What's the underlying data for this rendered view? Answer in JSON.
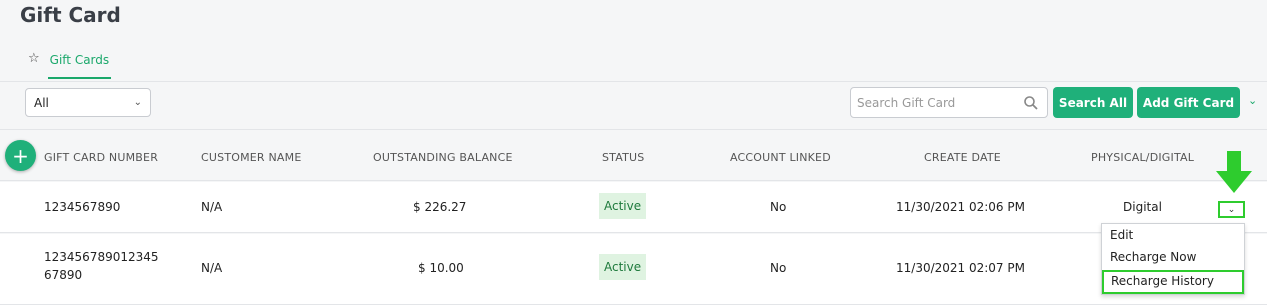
{
  "page": {
    "title": "Gift Card"
  },
  "tabs": [
    {
      "label": "Gift Cards",
      "icon": "star-icon",
      "active": true
    }
  ],
  "toolbar": {
    "filter_value": "All",
    "search_placeholder": "Search Gift Card",
    "search_all_label": "Search All",
    "add_label": "Add Gift Card"
  },
  "table": {
    "headers": [
      "GIFT CARD NUMBER",
      "CUSTOMER NAME",
      "OUTSTANDING BALANCE",
      "STATUS",
      "ACCOUNT LINKED",
      "CREATE DATE",
      "PHYSICAL/DIGITAL"
    ],
    "rows": [
      {
        "number_line1": "1234567890",
        "number_line2": "",
        "customer": "N/A",
        "balance": "$ 226.27",
        "status": "Active",
        "linked": "No",
        "date": "11/30/2021 02:06 PM",
        "type": "Digital"
      },
      {
        "number_line1": "123456789012345",
        "number_line2": "67890",
        "customer": "N/A",
        "balance": "$ 10.00",
        "status": "Active",
        "linked": "No",
        "date": "11/30/2021 02:07 PM",
        "type": ""
      }
    ]
  },
  "row_menu": {
    "items": [
      "Edit",
      "Recharge Now",
      "Recharge History"
    ]
  },
  "colors": {
    "accent": "#1fb07a",
    "highlight": "#2ecc2e",
    "badge_bg": "#dff3e1"
  }
}
